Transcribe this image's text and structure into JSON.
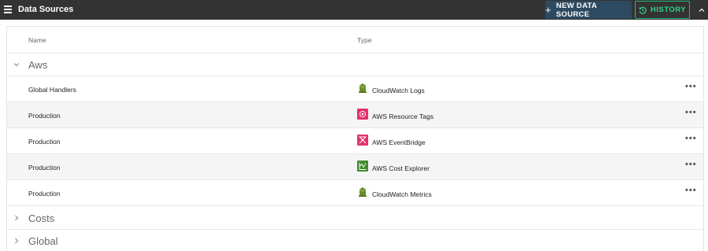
{
  "header": {
    "title": "Data Sources",
    "new_button_label": "NEW DATA SOURCE",
    "history_button_label": "HISTORY"
  },
  "table": {
    "columns": [
      "Name",
      "Type"
    ]
  },
  "groups": [
    {
      "name": "Aws",
      "expanded": true,
      "items": [
        {
          "name": "Global Handlers",
          "type": "CloudWatch Logs",
          "icon": "cloudwatch-icon"
        },
        {
          "name": "Production",
          "type": "AWS Resource Tags",
          "icon": "resource-tags-icon"
        },
        {
          "name": "Production",
          "type": "AWS EventBridge",
          "icon": "eventbridge-icon"
        },
        {
          "name": "Production",
          "type": "AWS Cost Explorer",
          "icon": "cost-explorer-icon"
        },
        {
          "name": "Production",
          "type": "CloudWatch Metrics",
          "icon": "cloudwatch-icon"
        }
      ]
    },
    {
      "name": "Costs",
      "expanded": false,
      "items": []
    },
    {
      "name": "Global",
      "expanded": false,
      "items": []
    }
  ],
  "row_menu_label": "•••",
  "colors": {
    "topbar": "#333333",
    "new_button": "#2d4a60",
    "history_accent": "#33d18d",
    "cloudwatch": "#6b8f2a",
    "resource_tags": "#e3306c",
    "eventbridge": "#e0336f",
    "cost_explorer": "#3f8b2e"
  }
}
